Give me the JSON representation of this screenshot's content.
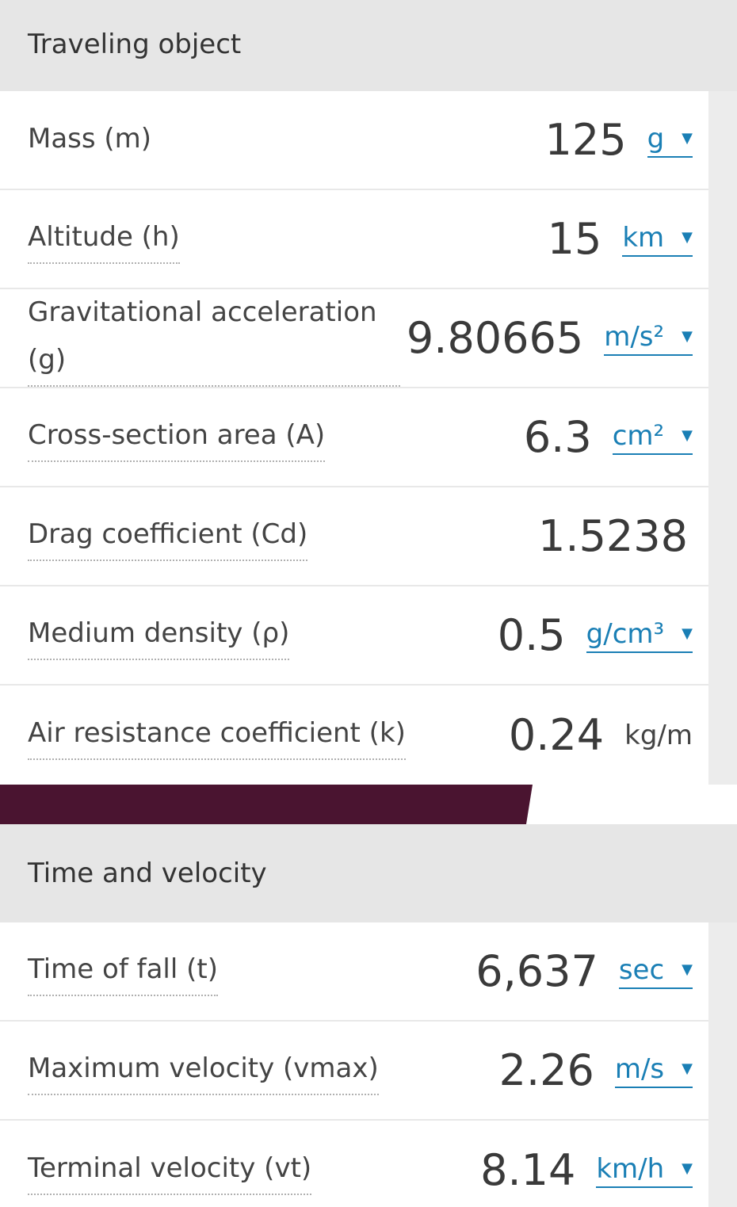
{
  "colors": {
    "header_bg": "#e6e6e6",
    "link": "#1a7fb5",
    "banner": "#4a1430"
  },
  "traveling_object": {
    "title": "Traveling object",
    "rows": [
      {
        "label": "Mass (m)",
        "value": "125",
        "unit": "g"
      },
      {
        "label": "Altitude (h)",
        "value": "15",
        "unit": "km"
      },
      {
        "label": "Gravitational acceleration (g)",
        "value": "9.80665",
        "unit": "m/s²"
      },
      {
        "label": "Cross-section area (A)",
        "value": "6.3",
        "unit": "cm²"
      },
      {
        "label": "Drag coefficient (Cd)",
        "value": "1.5238"
      },
      {
        "label": "Medium density (ρ)",
        "value": "0.5",
        "unit": "g/cm³"
      },
      {
        "label": "Air resistance coefficient (k)",
        "value": "0.24",
        "unit": "kg/m"
      }
    ]
  },
  "time_velocity": {
    "title": "Time and velocity",
    "rows": [
      {
        "label": "Time of fall (t)",
        "value": "6,637",
        "unit": "sec"
      },
      {
        "label": "Maximum velocity (vmax)",
        "value": "2.26",
        "unit": "m/s"
      },
      {
        "label": "Terminal velocity (vt)",
        "value": "8.14",
        "unit": "km/h"
      }
    ]
  },
  "icons": {
    "dropdown": "caret-down-icon"
  }
}
